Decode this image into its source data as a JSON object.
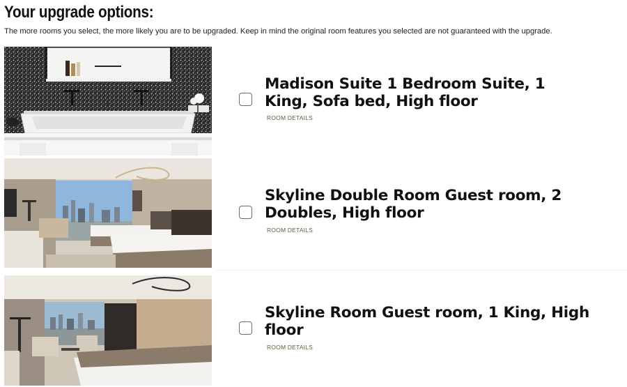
{
  "header": {
    "title": "Your upgrade options:",
    "intro": "The more rooms you select, the more likely you are to be upgraded. Keep in mind the original room features you selected are not guaranteed with the upgrade."
  },
  "rooms": [
    {
      "name": "Madison Suite 1 Bedroom Suite, 1 King, Sofa bed, High floor",
      "details_label": "ROOM DETAILS",
      "checked": false,
      "photo": "bathroom-sink-photo"
    },
    {
      "name": "Skyline Double Room Guest room, 2 Doubles, High floor",
      "details_label": "ROOM DETAILS",
      "checked": false,
      "photo": "double-bedroom-photo"
    },
    {
      "name": "Skyline Room Guest room, 1 King, High floor",
      "details_label": "ROOM DETAILS",
      "checked": false,
      "photo": "king-bedroom-photo"
    }
  ]
}
